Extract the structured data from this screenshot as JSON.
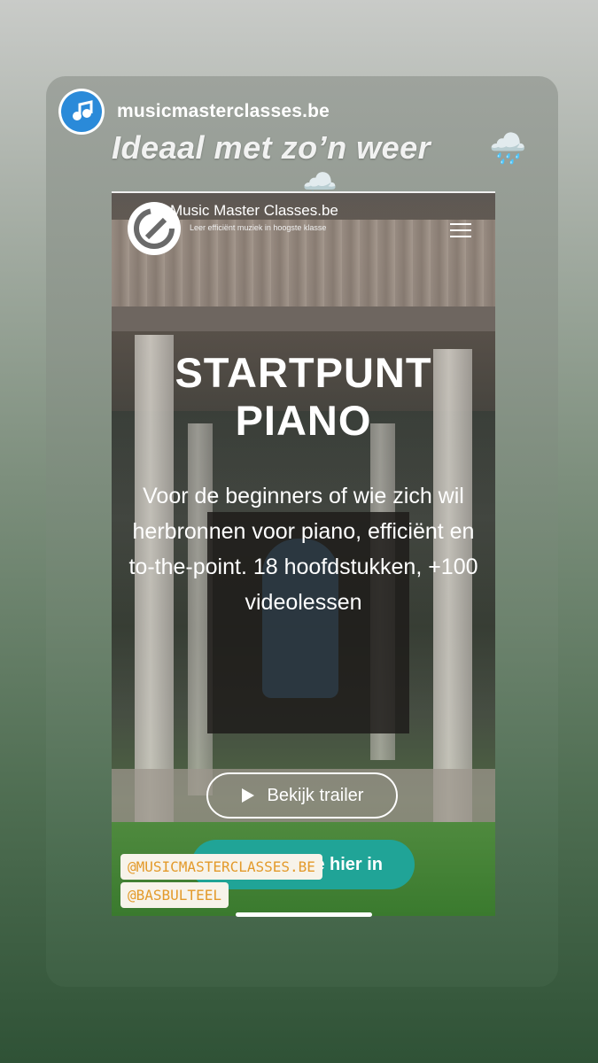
{
  "story": {
    "username": "musicmasterclasses.be",
    "caption": "Ideaal met zo’n weer",
    "caption_emoji": "🌧️",
    "caption_emoji_2": "🌧️"
  },
  "site": {
    "name": "Music Master Classes.be",
    "tagline": "Leer efficiënt muziek in hoogste klasse",
    "hero_title": "STARTPUNT PIANO",
    "hero_description": "Voor de beginners of wie zich wil herbronnen voor piano, efficiënt en to-the-point. 18 hoofdstukken, +100 videolessen",
    "trailer_button": "Bekijk trailer",
    "enroll_button": "Schrijf je hier in",
    "menu_icon": "hamburger-menu-icon",
    "play_icon": "play-icon",
    "cart_icon": "cart-icon"
  },
  "mentions": [
    "@MUSICMASTERCLASSES.BE",
    "@BASBULTEEL"
  ],
  "colors": {
    "accent": "#20a497",
    "mention_text": "#e39a2b",
    "avatar_bg": "#2a8ad9"
  }
}
